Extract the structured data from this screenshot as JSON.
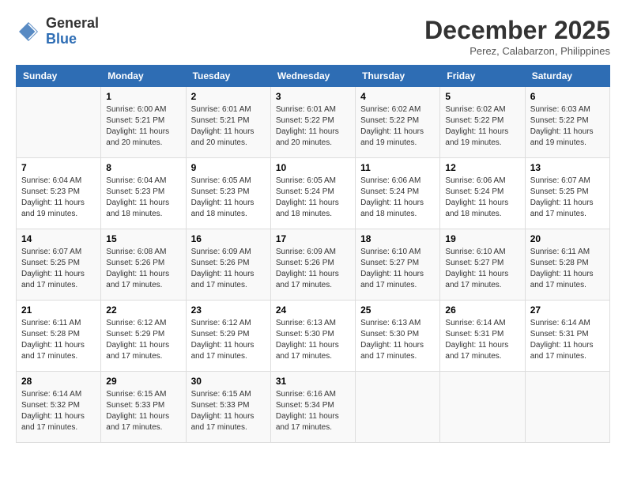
{
  "header": {
    "logo": {
      "general": "General",
      "blue": "Blue"
    },
    "title": "December 2025",
    "location": "Perez, Calabarzon, Philippines"
  },
  "calendar": {
    "days_of_week": [
      "Sunday",
      "Monday",
      "Tuesday",
      "Wednesday",
      "Thursday",
      "Friday",
      "Saturday"
    ],
    "weeks": [
      [
        {
          "day": "",
          "info": ""
        },
        {
          "day": "1",
          "info": "Sunrise: 6:00 AM\nSunset: 5:21 PM\nDaylight: 11 hours\nand 20 minutes."
        },
        {
          "day": "2",
          "info": "Sunrise: 6:01 AM\nSunset: 5:21 PM\nDaylight: 11 hours\nand 20 minutes."
        },
        {
          "day": "3",
          "info": "Sunrise: 6:01 AM\nSunset: 5:22 PM\nDaylight: 11 hours\nand 20 minutes."
        },
        {
          "day": "4",
          "info": "Sunrise: 6:02 AM\nSunset: 5:22 PM\nDaylight: 11 hours\nand 19 minutes."
        },
        {
          "day": "5",
          "info": "Sunrise: 6:02 AM\nSunset: 5:22 PM\nDaylight: 11 hours\nand 19 minutes."
        },
        {
          "day": "6",
          "info": "Sunrise: 6:03 AM\nSunset: 5:22 PM\nDaylight: 11 hours\nand 19 minutes."
        }
      ],
      [
        {
          "day": "7",
          "info": "Sunrise: 6:04 AM\nSunset: 5:23 PM\nDaylight: 11 hours\nand 19 minutes."
        },
        {
          "day": "8",
          "info": "Sunrise: 6:04 AM\nSunset: 5:23 PM\nDaylight: 11 hours\nand 18 minutes."
        },
        {
          "day": "9",
          "info": "Sunrise: 6:05 AM\nSunset: 5:23 PM\nDaylight: 11 hours\nand 18 minutes."
        },
        {
          "day": "10",
          "info": "Sunrise: 6:05 AM\nSunset: 5:24 PM\nDaylight: 11 hours\nand 18 minutes."
        },
        {
          "day": "11",
          "info": "Sunrise: 6:06 AM\nSunset: 5:24 PM\nDaylight: 11 hours\nand 18 minutes."
        },
        {
          "day": "12",
          "info": "Sunrise: 6:06 AM\nSunset: 5:24 PM\nDaylight: 11 hours\nand 18 minutes."
        },
        {
          "day": "13",
          "info": "Sunrise: 6:07 AM\nSunset: 5:25 PM\nDaylight: 11 hours\nand 17 minutes."
        }
      ],
      [
        {
          "day": "14",
          "info": "Sunrise: 6:07 AM\nSunset: 5:25 PM\nDaylight: 11 hours\nand 17 minutes."
        },
        {
          "day": "15",
          "info": "Sunrise: 6:08 AM\nSunset: 5:26 PM\nDaylight: 11 hours\nand 17 minutes."
        },
        {
          "day": "16",
          "info": "Sunrise: 6:09 AM\nSunset: 5:26 PM\nDaylight: 11 hours\nand 17 minutes."
        },
        {
          "day": "17",
          "info": "Sunrise: 6:09 AM\nSunset: 5:26 PM\nDaylight: 11 hours\nand 17 minutes."
        },
        {
          "day": "18",
          "info": "Sunrise: 6:10 AM\nSunset: 5:27 PM\nDaylight: 11 hours\nand 17 minutes."
        },
        {
          "day": "19",
          "info": "Sunrise: 6:10 AM\nSunset: 5:27 PM\nDaylight: 11 hours\nand 17 minutes."
        },
        {
          "day": "20",
          "info": "Sunrise: 6:11 AM\nSunset: 5:28 PM\nDaylight: 11 hours\nand 17 minutes."
        }
      ],
      [
        {
          "day": "21",
          "info": "Sunrise: 6:11 AM\nSunset: 5:28 PM\nDaylight: 11 hours\nand 17 minutes."
        },
        {
          "day": "22",
          "info": "Sunrise: 6:12 AM\nSunset: 5:29 PM\nDaylight: 11 hours\nand 17 minutes."
        },
        {
          "day": "23",
          "info": "Sunrise: 6:12 AM\nSunset: 5:29 PM\nDaylight: 11 hours\nand 17 minutes."
        },
        {
          "day": "24",
          "info": "Sunrise: 6:13 AM\nSunset: 5:30 PM\nDaylight: 11 hours\nand 17 minutes."
        },
        {
          "day": "25",
          "info": "Sunrise: 6:13 AM\nSunset: 5:30 PM\nDaylight: 11 hours\nand 17 minutes."
        },
        {
          "day": "26",
          "info": "Sunrise: 6:14 AM\nSunset: 5:31 PM\nDaylight: 11 hours\nand 17 minutes."
        },
        {
          "day": "27",
          "info": "Sunrise: 6:14 AM\nSunset: 5:31 PM\nDaylight: 11 hours\nand 17 minutes."
        }
      ],
      [
        {
          "day": "28",
          "info": "Sunrise: 6:14 AM\nSunset: 5:32 PM\nDaylight: 11 hours\nand 17 minutes."
        },
        {
          "day": "29",
          "info": "Sunrise: 6:15 AM\nSunset: 5:33 PM\nDaylight: 11 hours\nand 17 minutes."
        },
        {
          "day": "30",
          "info": "Sunrise: 6:15 AM\nSunset: 5:33 PM\nDaylight: 11 hours\nand 17 minutes."
        },
        {
          "day": "31",
          "info": "Sunrise: 6:16 AM\nSunset: 5:34 PM\nDaylight: 11 hours\nand 17 minutes."
        },
        {
          "day": "",
          "info": ""
        },
        {
          "day": "",
          "info": ""
        },
        {
          "day": "",
          "info": ""
        }
      ]
    ]
  }
}
